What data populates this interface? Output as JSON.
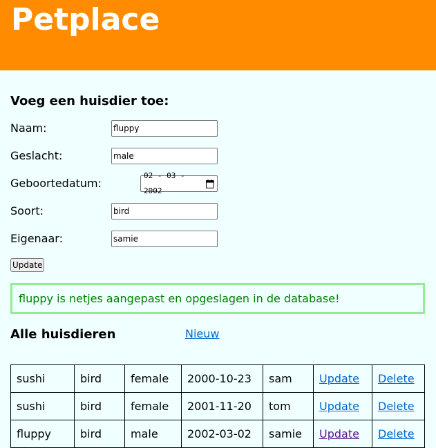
{
  "header": {
    "title": "Petplace"
  },
  "form": {
    "title": "Voeg een huisdier toe:",
    "fields": {
      "naam": {
        "label": "Naam:",
        "value": "fluppy"
      },
      "geslacht": {
        "label": "Geslacht:",
        "value": "male"
      },
      "geboortedatum": {
        "label": "Geboortedatum:",
        "value": "02 - 03 - 2002"
      },
      "soort": {
        "label": "Soort:",
        "value": "bird"
      },
      "eigenaar": {
        "label": "Eigenaar:",
        "value": "samie"
      }
    },
    "submit_label": "Update"
  },
  "alert": {
    "message": "fluppy is netjes aangepast en opgeslagen in de database!"
  },
  "list": {
    "title": "Alle huisdieren",
    "new_link": "Nieuw",
    "rows": [
      {
        "name": "sushi",
        "species": "bird",
        "gender": "female",
        "birthdate": "2000-10-23",
        "owner": "sam",
        "update": "Update",
        "delete": "Delete"
      },
      {
        "name": "sushi",
        "species": "bird",
        "gender": "female",
        "birthdate": "2001-11-20",
        "owner": "tom",
        "update": "Update",
        "delete": "Delete"
      },
      {
        "name": "fluppy",
        "species": "bird",
        "gender": "male",
        "birthdate": "2002-03-02",
        "owner": "samie",
        "update": "Update",
        "delete": "Delete"
      }
    ]
  },
  "colors": {
    "header_bg": "#ff8c00",
    "page_bg": "#f0ffff",
    "alert_border": "#90ee90",
    "alert_text": "#008000",
    "link": "#0066cc",
    "visited_link": "#551a8b"
  }
}
